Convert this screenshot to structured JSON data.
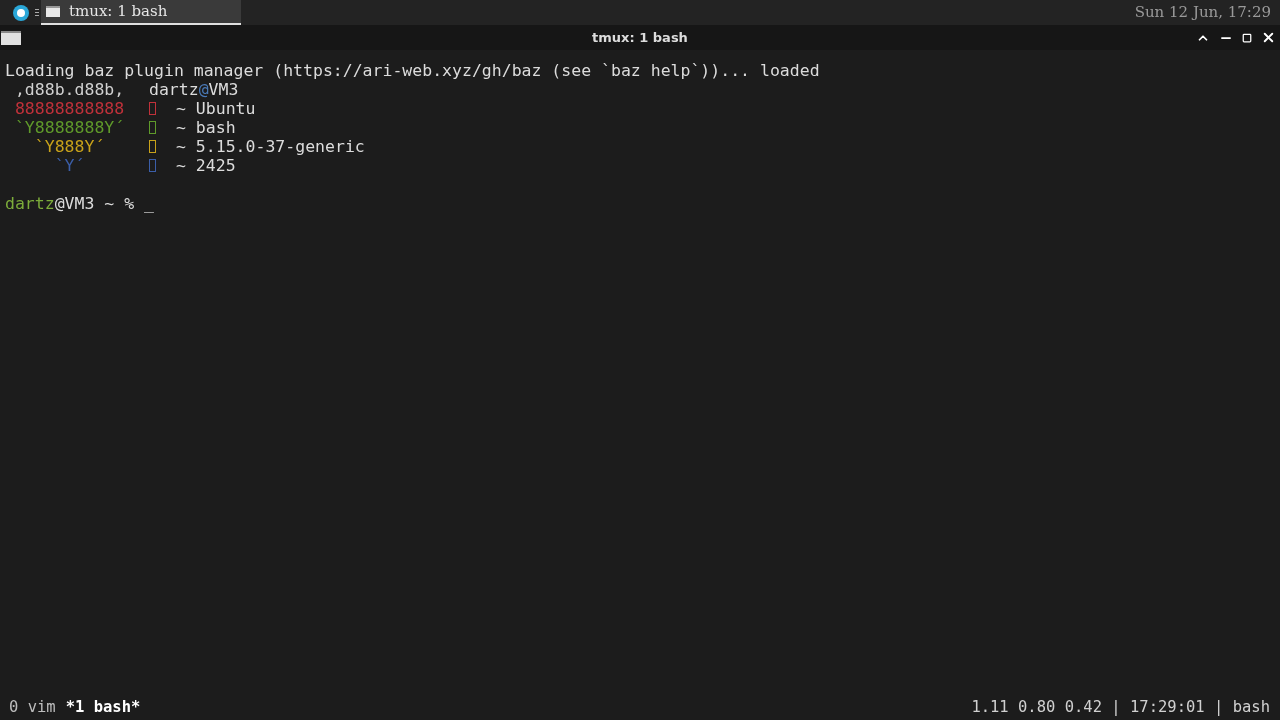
{
  "taskbar": {
    "tabs": [
      {
        "title": "tmux: 1 bash",
        "selected": true
      }
    ],
    "clock": "Sun 12 Jun, 17:29"
  },
  "window": {
    "title": "tmux: 1 bash"
  },
  "terminal": {
    "loading_line": "Loading baz plugin manager (https://ari-web.xyz/gh/baz (see `baz help`))... loaded",
    "fetch": [
      {
        "kind": "header",
        "art": " ,d88b.d88b,",
        "color": "#d0d0d0",
        "user": "dartz",
        "at": "@",
        "host": "VM3"
      },
      {
        "kind": "info",
        "art": " 88888888888",
        "color": "#c0313a",
        "text": "~ Ubuntu"
      },
      {
        "kind": "info",
        "art": " `Y8888888Y´",
        "color": "#5f9a2a",
        "text": "~ bash"
      },
      {
        "kind": "info",
        "art": "   `Y888Y´",
        "color": "#c8a21a",
        "text": "~ 5.15.0-37-generic"
      },
      {
        "kind": "info",
        "art": "     `Y´",
        "color": "#3b5ea8",
        "text": "~ 2425"
      }
    ],
    "prompt": {
      "user": "dartz",
      "rest": "@VM3 ~ %",
      "cursor": "_"
    }
  },
  "status_bar": {
    "windows": [
      {
        "label": "0 vim",
        "selected": false
      },
      {
        "label": "*1 bash*",
        "selected": true
      }
    ],
    "right": "1.11 0.80 0.42 | 17:29:01 | bash"
  }
}
